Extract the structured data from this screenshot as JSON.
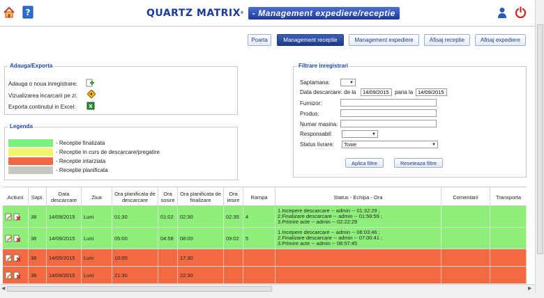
{
  "header": {
    "brand_main": "QUARTZ MATRIX",
    "brand_mark": "®",
    "brand_sub": "- Management expediere/receptie"
  },
  "nav": [
    {
      "label": "Poarta",
      "active": false
    },
    {
      "label": "Management receptie",
      "active": true
    },
    {
      "label": "Management expediere",
      "active": false
    },
    {
      "label": "Afisaj receptie",
      "active": false
    },
    {
      "label": "Afisaj expediere",
      "active": false
    }
  ],
  "add_export": {
    "title": "Adauga/Exporta",
    "add_label": "Adauga o noua inregistrare:",
    "view_label": "Vizualizarea incarcarii pe zi:",
    "export_label": "Exporta continutul in Excel:"
  },
  "legend": {
    "title": "Legenda",
    "items": [
      {
        "color": "#7cf07c",
        "label": "- Receptie finalizata"
      },
      {
        "color": "#f4f46a",
        "label": "- Receptie in curs de descarcare/pregatire"
      },
      {
        "color": "#f26a42",
        "label": "- Receptie intarziata"
      },
      {
        "color": "#c8c8c0",
        "label": "- Receptie planificata"
      }
    ]
  },
  "filter": {
    "title": "Filtrare inregistrari",
    "week_label": "Saptamana:",
    "week_value": "",
    "date_label": "Data descarcare: de la",
    "date_from": "14/09/2015",
    "date_to_label": "pana la",
    "date_to": "14/09/2015",
    "supplier_label": "Furnizor:",
    "product_label": "Produs:",
    "car_label": "Numar masina:",
    "responsible_label": "Responsabil:",
    "status_label": "Status livrare:",
    "status_value": "Toate",
    "apply_label": "Aplica filtre",
    "reset_label": "Reseteaza filtre"
  },
  "table": {
    "columns": [
      "Actiuni",
      "Sapt.",
      "Data descarcare",
      "Ziua",
      "Ora planificata de descarcare",
      "Ora sosire",
      "Ora planificata de finalizare",
      "Ora iesire",
      "Rampa",
      "Status - Echipa - Ora",
      "Comentarii",
      "Transporta"
    ],
    "rows": [
      {
        "color": "#8ef07a",
        "week": "38",
        "date": "14/09/2015",
        "day": "Luni",
        "planned_unload": "01:30",
        "arrival": "01:02",
        "planned_finish": "02:30",
        "exit": "02:35",
        "ramp": "4",
        "status": [
          "1.Incepere descarcare -- admin -- 01:32:29 ;",
          "2.Finalizare descarcare -- admin -- 01:59:59 ;",
          "3.Primire acte -- admin -- 02:22:29"
        ]
      },
      {
        "color": "#8ef07a",
        "week": "38",
        "date": "14/09/2015",
        "day": "Luni",
        "planned_unload": "05:00",
        "arrival": "04:58",
        "planned_finish": "08:00",
        "exit": "09:02",
        "ramp": "5",
        "status": [
          "1.Incepere descarcare -- admin -- 06:03:46 ;",
          "2.Finalizare descarcare -- admin -- 07:00:41 ;",
          "3.Primire acte -- admin -- 08:57:45"
        ]
      },
      {
        "color": "#f26a42",
        "week": "38",
        "date": "14/09/2015",
        "day": "Luni",
        "planned_unload": "10:00",
        "arrival": "",
        "planned_finish": "17:30",
        "exit": "",
        "ramp": "",
        "status": [
          "",
          "",
          ""
        ]
      },
      {
        "color": "#f26a42",
        "week": "38",
        "date": "14/09/2015",
        "day": "Luni",
        "planned_unload": "21:30",
        "arrival": "",
        "planned_finish": "22:30",
        "exit": "",
        "ramp": "",
        "status": [
          "",
          "",
          ""
        ]
      }
    ]
  }
}
